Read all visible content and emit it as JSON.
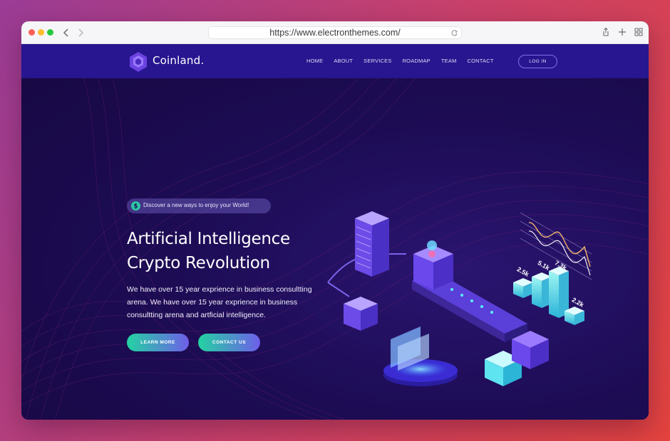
{
  "browser": {
    "url": "https://www.electronthemes.com/",
    "traffic_lights": [
      "#fe5f57",
      "#febc2e",
      "#28c840"
    ]
  },
  "navbar": {
    "brand": "Coinland.",
    "menu": [
      "HOME",
      "ABOUT",
      "SERVICES",
      "ROADMAP",
      "TEAM",
      "CONTACT"
    ],
    "login_label": "LOG IN"
  },
  "hero": {
    "badge_text": "Discover a new ways to enjoy your World!",
    "badge_icon": "dollar-coin-icon",
    "headline_line1": "Artificial Intelligence",
    "headline_line2": "Crypto Revolution",
    "description": "We have over 15 year exprience in business consultting arena. We have over 15 year exprience in business consultting arena and artficial intelligence.",
    "buttons": {
      "learn_more": "LEARN MORE",
      "contact_us": "CONTACT US"
    }
  },
  "illustration": {
    "labels": [
      "2.5k",
      "5.1k",
      "7.3k",
      "2.2k"
    ]
  },
  "colors": {
    "navbar_bg": "#27168f",
    "page_bg": "#1d0c55",
    "accent_teal": "#23d3a2",
    "accent_purple": "#6f5ee9"
  }
}
